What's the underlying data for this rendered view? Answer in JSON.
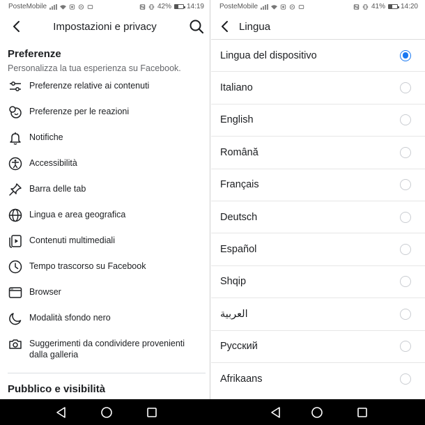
{
  "left": {
    "status": {
      "carrier": "PosteMobile",
      "battery_pct": "42%",
      "battery_level": 0.42,
      "time": "14:19"
    },
    "header": {
      "title": "Impostazioni e privacy"
    },
    "section1": {
      "title": "Preferenze",
      "subtitle": "Personalizza la tua esperienza su Facebook.",
      "items": [
        {
          "label": "Preferenze relative ai contenuti",
          "icon": "sliders-icon"
        },
        {
          "label": "Preferenze per le reazioni",
          "icon": "reactions-icon"
        },
        {
          "label": "Notifiche",
          "icon": "bell-icon"
        },
        {
          "label": "Accessibilità",
          "icon": "accessibility-icon"
        },
        {
          "label": "Barra delle tab",
          "icon": "pin-icon"
        },
        {
          "label": "Lingua e area geografica",
          "icon": "globe-icon"
        },
        {
          "label": "Contenuti multimediali",
          "icon": "media-icon"
        },
        {
          "label": "Tempo trascorso su Facebook",
          "icon": "clock-icon"
        },
        {
          "label": "Browser",
          "icon": "browser-icon"
        },
        {
          "label": "Modalità sfondo nero",
          "icon": "moon-icon"
        },
        {
          "label": "Suggerimenti da condividere provenienti dalla galleria",
          "icon": "camera-icon"
        }
      ]
    },
    "section2": {
      "title": "Pubblico e visibilità"
    }
  },
  "right": {
    "status": {
      "carrier": "PosteMobile",
      "battery_pct": "41%",
      "battery_level": 0.41,
      "time": "14:20"
    },
    "header": {
      "title": "Lingua"
    },
    "languages": [
      {
        "label": "Lingua del dispositivo",
        "selected": true
      },
      {
        "label": "Italiano",
        "selected": false
      },
      {
        "label": "English",
        "selected": false
      },
      {
        "label": "Română",
        "selected": false
      },
      {
        "label": "Français",
        "selected": false
      },
      {
        "label": "Deutsch",
        "selected": false
      },
      {
        "label": "Español",
        "selected": false
      },
      {
        "label": "Shqip",
        "selected": false
      },
      {
        "label": "العربية",
        "selected": false
      },
      {
        "label": "Русский",
        "selected": false
      },
      {
        "label": "Afrikaans",
        "selected": false
      }
    ]
  },
  "colors": {
    "accent": "#1877f2",
    "text": "#1c1e21",
    "secondary": "#65676b",
    "navbar": "#000000"
  },
  "navbar": {
    "buttons": [
      "back-nav-icon",
      "home-nav-icon",
      "recents-nav-icon"
    ]
  }
}
